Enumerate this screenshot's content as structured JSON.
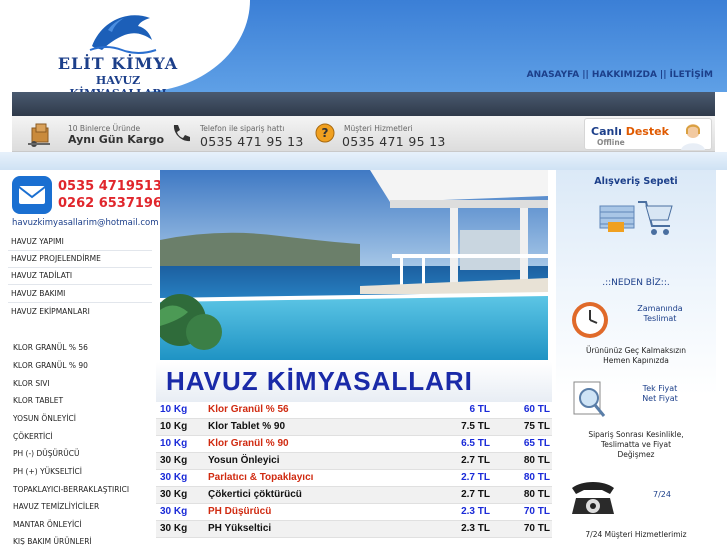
{
  "brand": {
    "name": "ELİT KİMYA",
    "subtitle": "HAVUZ KİMYASALLARI"
  },
  "topnav": [
    {
      "label": "ANASAYFA"
    },
    {
      "label": "HAKKIMIZDA"
    },
    {
      "label": "İLETİŞİM"
    }
  ],
  "topnav_sep": "||",
  "infobar": {
    "delivery_small": "10 Binlerce Üründe",
    "delivery_big": "Aynı Gün Kargo",
    "order_small": "Telefon ile sipariş hattı",
    "order_phone": "0535 471 95 13",
    "service_small": "Müşteri Hizmetleri",
    "service_phone": "0535 471 95 13"
  },
  "live_support": {
    "title_prefix": "Canlı",
    "title_bold": "Destek",
    "status": "Offline"
  },
  "contact": {
    "phone1": "0535 4719513",
    "phone2": "0262 6537196",
    "email": "havuzkimyasallarim@hotmail.com"
  },
  "menu_top": [
    {
      "label": "HAVUZ YAPIMI"
    },
    {
      "label": "HAVUZ PROJELENDİRME"
    },
    {
      "label": "HAVUZ TADİLATI"
    },
    {
      "label": "HAVUZ BAKIMI"
    },
    {
      "label": "HAVUZ EKİPMANLARI"
    }
  ],
  "menu_products": [
    {
      "label": "KLOR GRANÜL % 56"
    },
    {
      "label": "KLOR GRANÜL % 90"
    },
    {
      "label": "KLOR SIVI"
    },
    {
      "label": "KLOR TABLET"
    },
    {
      "label": "YOSUN ÖNLEYİCİ"
    },
    {
      "label": "ÇÖKERTİCİ"
    },
    {
      "label": "PH (-) DÜŞÜRÜCÜ"
    },
    {
      "label": "PH (+) YÜKSELTİCİ"
    },
    {
      "label": "TOPAKLAYICI-BERRAKLAŞTIRICI"
    },
    {
      "label": "HAVUZ TEMİZLİYİCİLER"
    },
    {
      "label": "MANTAR ÖNLEYİCİ"
    },
    {
      "label": "KIŞ BAKIM ÜRÜNLERİ"
    }
  ],
  "main_title": "HAVUZ KİMYASALLARI",
  "price_rows": [
    {
      "qty": "10 Kg",
      "name": "Klor Granül % 56",
      "p1": "6 TL",
      "p2": "60 TL",
      "style": "blue"
    },
    {
      "qty": "10 Kg",
      "name": "Klor Tablet  % 90",
      "p1": "7.5 TL",
      "p2": "75 TL",
      "style": "black"
    },
    {
      "qty": "10 Kg",
      "name": "Klor Granül % 90",
      "p1": "6.5 TL",
      "p2": "65 TL",
      "style": "blue"
    },
    {
      "qty": "30 Kg",
      "name": "Yosun Önleyici",
      "p1": "2.7 TL",
      "p2": "80 TL",
      "style": "black"
    },
    {
      "qty": "30 Kg",
      "name": "Parlatıcı & Topaklayıcı",
      "p1": "2.7 TL",
      "p2": "80 TL",
      "style": "blue"
    },
    {
      "qty": "30 Kg",
      "name": "Çökertici çöktürücü",
      "p1": "2.7 TL",
      "p2": "80 TL",
      "style": "black"
    },
    {
      "qty": "30 Kg",
      "name": "PH Düşürücü",
      "p1": "2.3 TL",
      "p2": "70 TL",
      "style": "blue"
    },
    {
      "qty": "30 Kg",
      "name": "PH Yükseltici",
      "p1": "2.3 TL",
      "p2": "70 TL",
      "style": "black"
    }
  ],
  "cart": {
    "title": "Alışveriş Sepeti"
  },
  "why": {
    "title": ".::NEDEN BİZ::.",
    "f1_label_1": "Zamanında",
    "f1_label_2": "Teslimat",
    "f1_desc_1": "Ürününüz Geç Kalmaksızın",
    "f1_desc_2": "Hemen Kapınızda",
    "f2_label_1": "Tek Fiyat",
    "f2_label_2": "Net Fiyat",
    "f2_desc_1": "Sipariş Sonrası Kesinlikle,",
    "f2_desc_2": "Teslimatta ve Fiyat",
    "f2_desc_3": "Değişmez",
    "f3_label": "7/24",
    "f3_desc_1": "7/24 Müşteri Hizmetlerimiz"
  },
  "colors": {
    "brand_blue": "#1c3f8a",
    "title_blue": "#1a2aa8",
    "price_blue": "#1a2ad8",
    "price_red": "#d02a10",
    "phone_red": "#e0262c"
  }
}
